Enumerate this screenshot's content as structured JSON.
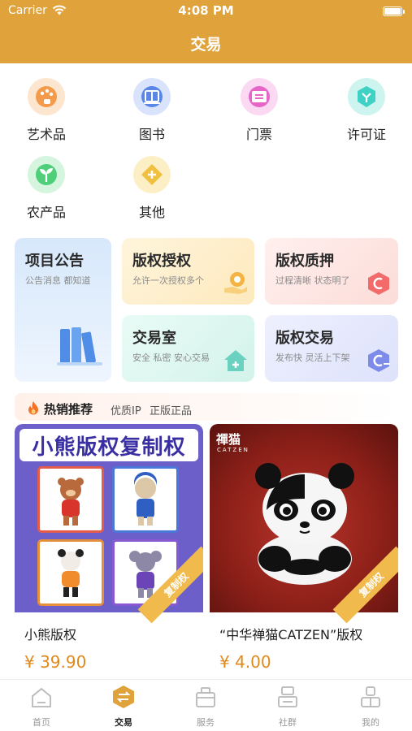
{
  "status_bar": {
    "carrier": "Carrier",
    "time": "4:08 PM"
  },
  "page": {
    "title": "交易"
  },
  "categories": [
    {
      "label": "艺术品",
      "icon": "palette-icon",
      "color": "#f39b4b"
    },
    {
      "label": "图书",
      "icon": "book-icon",
      "color": "#5a86e8"
    },
    {
      "label": "门票",
      "icon": "ticket-icon",
      "color": "#e865c8"
    },
    {
      "label": "许可证",
      "icon": "license-icon",
      "color": "#3fd1c3"
    },
    {
      "label": "农产品",
      "icon": "sprout-icon",
      "color": "#4fcf7a"
    },
    {
      "label": "其他",
      "icon": "plus-icon",
      "color": "#f0c040"
    }
  ],
  "cards": {
    "announce": {
      "title": "项目公告",
      "subtitle": "公告消息 都知道"
    },
    "license": {
      "title": "版权授权",
      "subtitle": "允许一次授权多个"
    },
    "pledge": {
      "title": "版权质押",
      "subtitle": "过程清晰 状态明了"
    },
    "room": {
      "title": "交易室",
      "subtitle": "安全 私密 安心交易"
    },
    "trade": {
      "title": "版权交易",
      "subtitle": "发布快 灵活上下架"
    }
  },
  "hot": {
    "title": "热销推荐",
    "tag1": "优质IP",
    "tag2": "正版正品"
  },
  "products": [
    {
      "name": "小熊版权",
      "price": "¥ 39.90",
      "banner": "小熊版权复制权",
      "ribbon": "复制权"
    },
    {
      "name": "“中华禅猫CATZEN”版权",
      "price": "¥ 4.00",
      "logo": "禪猫",
      "logo_sub": "CATZEN",
      "ribbon": "复制权"
    }
  ],
  "tabs": [
    {
      "label": "首页",
      "icon": "home-icon"
    },
    {
      "label": "交易",
      "icon": "exchange-icon",
      "active": true
    },
    {
      "label": "服务",
      "icon": "service-icon"
    },
    {
      "label": "社群",
      "icon": "community-icon"
    },
    {
      "label": "我的",
      "icon": "profile-icon"
    }
  ]
}
